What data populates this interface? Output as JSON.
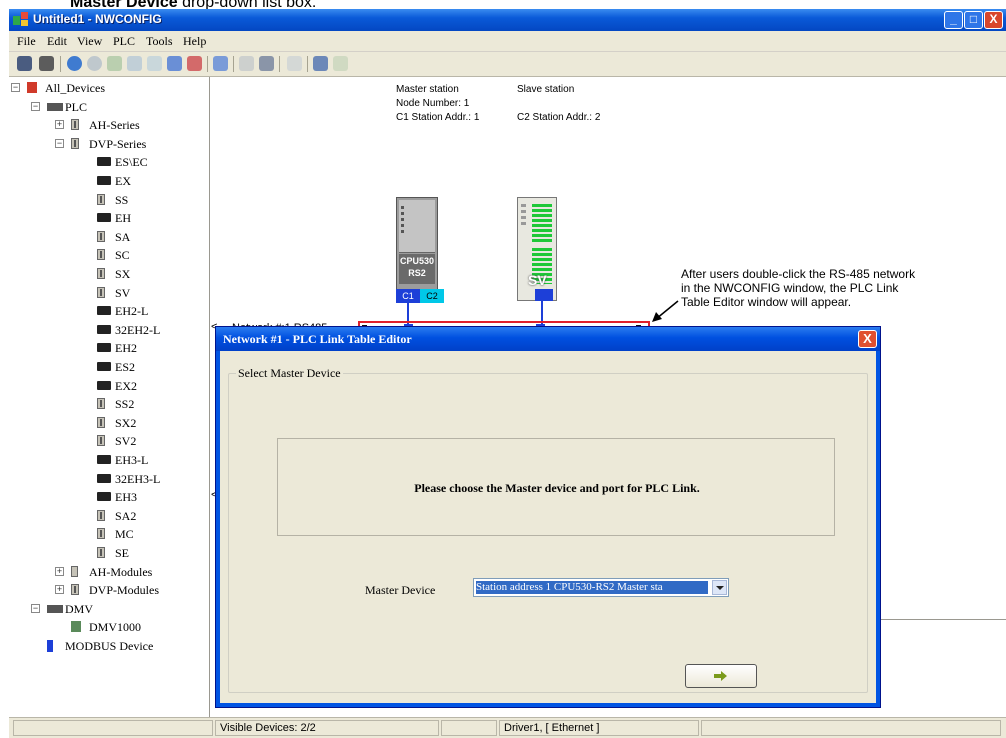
{
  "doc_caption": {
    "bold": "Master Device",
    "rest": " drop-down list box."
  },
  "window": {
    "title": "Untitled1 - NWCONFIG",
    "minimize": "_",
    "maximize": "□",
    "close": "X"
  },
  "menu": [
    {
      "label": "File"
    },
    {
      "label": "Edit"
    },
    {
      "label": "View"
    },
    {
      "label": "PLC"
    },
    {
      "label": "Tools"
    },
    {
      "label": "Help"
    }
  ],
  "toolbar_icons": [
    "save-icon",
    "print-icon",
    "connect-icon",
    "disconnect-icon",
    "upload-icon",
    "download-icon",
    "monitor-icon",
    "network-add-icon",
    "network-delete-icon",
    "station-icon",
    "property-icon",
    "list-icon",
    "settings-icon",
    "comm-icon",
    "chart-icon"
  ],
  "tree": [
    {
      "label": "All_Devices",
      "depth": 0,
      "icon": "devices-icon",
      "expander": "−"
    },
    {
      "label": "PLC",
      "depth": 1,
      "icon": "plc-icon",
      "expander": "−"
    },
    {
      "label": "AH-Series",
      "depth": 2,
      "icon": "dvp-icon",
      "expander": "+"
    },
    {
      "label": "DVP-Series",
      "depth": 2,
      "icon": "dvp-icon",
      "expander": "−"
    },
    {
      "label": "ES\\EC",
      "depth": 3,
      "icon": "ex-icon"
    },
    {
      "label": "EX",
      "depth": 3,
      "icon": "ex-icon"
    },
    {
      "label": "SS",
      "depth": 3,
      "icon": "dvp-icon"
    },
    {
      "label": "EH",
      "depth": 3,
      "icon": "ex-icon"
    },
    {
      "label": "SA",
      "depth": 3,
      "icon": "dvp-icon"
    },
    {
      "label": "SC",
      "depth": 3,
      "icon": "dvp-icon"
    },
    {
      "label": "SX",
      "depth": 3,
      "icon": "dvp-icon"
    },
    {
      "label": "SV",
      "depth": 3,
      "icon": "dvp-icon"
    },
    {
      "label": "EH2-L",
      "depth": 3,
      "icon": "ex-icon"
    },
    {
      "label": "32EH2-L",
      "depth": 3,
      "icon": "ex-icon"
    },
    {
      "label": "EH2",
      "depth": 3,
      "icon": "ex-icon"
    },
    {
      "label": "ES2",
      "depth": 3,
      "icon": "ex-icon"
    },
    {
      "label": "EX2",
      "depth": 3,
      "icon": "ex-icon"
    },
    {
      "label": "SS2",
      "depth": 3,
      "icon": "dvp-icon"
    },
    {
      "label": "SX2",
      "depth": 3,
      "icon": "dvp-icon"
    },
    {
      "label": "SV2",
      "depth": 3,
      "icon": "dvp-icon"
    },
    {
      "label": "EH3-L",
      "depth": 3,
      "icon": "ex-icon"
    },
    {
      "label": "32EH3-L",
      "depth": 3,
      "icon": "ex-icon"
    },
    {
      "label": "EH3",
      "depth": 3,
      "icon": "ex-icon"
    },
    {
      "label": "SA2",
      "depth": 3,
      "icon": "dvp-icon"
    },
    {
      "label": "MC",
      "depth": 3,
      "icon": "dvp-icon"
    },
    {
      "label": "SE",
      "depth": 3,
      "icon": "dvp-icon"
    },
    {
      "label": "AH-Modules",
      "depth": 2,
      "icon": "module-icon",
      "expander": "+"
    },
    {
      "label": "DVP-Modules",
      "depth": 2,
      "icon": "dvp-icon",
      "expander": "+"
    },
    {
      "label": "DMV",
      "depth": 1,
      "icon": "plc-icon",
      "expander": "−"
    },
    {
      "label": "DMV1000",
      "depth": 2,
      "icon": "dmv-icon"
    },
    {
      "label": "MODBUS Device",
      "depth": 1,
      "icon": "modbus-icon"
    }
  ],
  "canvas": {
    "master": {
      "title": "Master station",
      "node": "Node Number: 1",
      "addr": "C1 Station Addr.: 1",
      "model": "CPU530",
      "model2": "RS2",
      "port1": "C1",
      "port2": "C2"
    },
    "slave": {
      "title": "Slave station",
      "addr": "C2 Station Addr.: 2",
      "model": "SV"
    },
    "network_label": "Network #:1  RS485",
    "annotation": [
      "After users double-click the RS-485 network",
      "in the NWCONFIG window, the PLC Link",
      "Table Editor window will appear."
    ],
    "collapse_arrow": "<"
  },
  "dialog": {
    "title": "Network #1 - PLC Link Table Editor",
    "close": "X",
    "group_title": "Select Master Device",
    "message": "Please choose the Master device and port for PLC Link.",
    "master_device_label": "Master Device",
    "master_device_value": "Station address 1  CPU530-RS2  Master sta"
  },
  "statusbar": {
    "visible_devices": "Visible Devices: 2/2",
    "driver": "Driver1, [  Ethernet  ]"
  },
  "colors": {
    "title_blue": "#0a5ad8",
    "network_red": "#e0202a",
    "link_blue": "#1d3fd8",
    "port_cyan": "#00c8e8",
    "green_io": "#1ec838"
  }
}
